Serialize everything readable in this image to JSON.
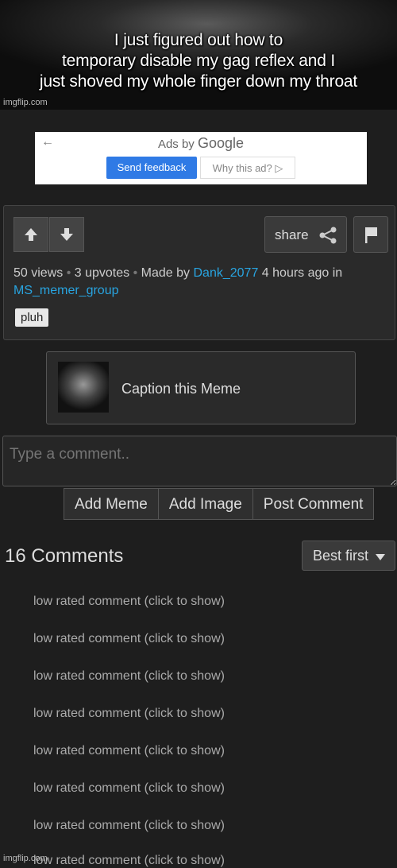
{
  "meme": {
    "caption_lines": [
      "I just figured out how to",
      "temporary disable my gag reflex and I",
      "just shoved my whole finger down my throat"
    ],
    "watermark": "imgflip.com"
  },
  "ad": {
    "ads_by": "Ads by",
    "brand": "Google",
    "send_feedback": "Send feedback",
    "why_this_ad": "Why this ad? ▷"
  },
  "post": {
    "share_label": "share",
    "views": "50 views",
    "upvotes": "3 upvotes",
    "made_by": "Made by",
    "author": "Dank_2077",
    "time": "4 hours ago in",
    "stream": "MS_memer_group",
    "tag": "pluh"
  },
  "caption_this": "Caption this Meme",
  "comment_box": {
    "placeholder": "Type a comment.."
  },
  "comment_actions": [
    "Add Meme",
    "Add Image",
    "Post Comment"
  ],
  "comments": {
    "count_label": "16 Comments",
    "sort_label": "Best first",
    "items": [
      "low rated comment (click to show)",
      "low rated comment (click to show)",
      "low rated comment (click to show)",
      "low rated comment (click to show)",
      "low rated comment (click to show)",
      "low rated comment (click to show)",
      "low rated comment (click to show)",
      "low rated comment (click to show)"
    ]
  },
  "footer_watermark": "imgflip.com",
  "colors": {
    "link": "#28a4e0",
    "feedback_button": "#2f7ae5",
    "background": "#1e1e1e"
  }
}
